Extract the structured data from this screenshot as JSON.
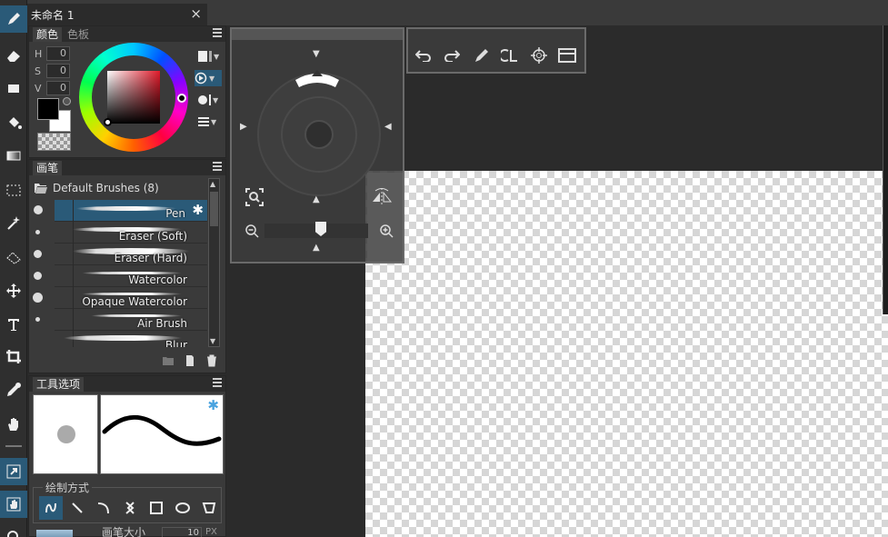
{
  "document": {
    "tab_title": "未命名 1",
    "close_glyph": "×"
  },
  "color_panel": {
    "tabs": [
      "颜色",
      "色板"
    ],
    "hsv": [
      {
        "label": "H",
        "value": "0"
      },
      {
        "label": "S",
        "value": "0"
      },
      {
        "label": "V",
        "value": "0"
      }
    ],
    "foreground": "#000000",
    "background": "#ffffff"
  },
  "brush_panel": {
    "tab": "画笔",
    "folder": "Default Brushes (8)",
    "brushes": [
      {
        "name": "Pen",
        "selected": true
      },
      {
        "name": "Eraser (Soft)"
      },
      {
        "name": "Eraser (Hard)"
      },
      {
        "name": "Watercolor"
      },
      {
        "name": "Opaque Watercolor"
      },
      {
        "name": "Air Brush"
      },
      {
        "name": "Blur"
      }
    ]
  },
  "tool_options": {
    "tab": "工具选项",
    "draw_mode_label": "绘制方式",
    "size_label": "画笔大小",
    "size_value": "10",
    "size_unit": "PX"
  },
  "colors": {
    "accent": "#2a5a78",
    "panel": "#3a3a3a",
    "gear": "#4aa3df"
  }
}
